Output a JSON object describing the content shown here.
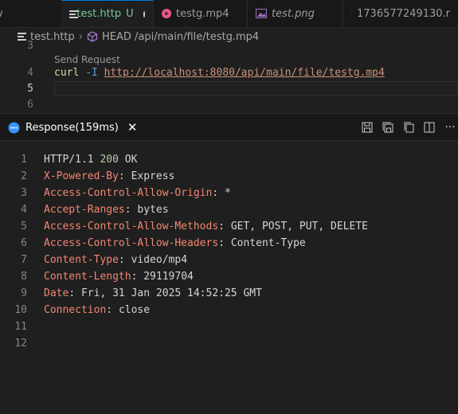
{
  "tabs": [
    {
      "label": "v"
    },
    {
      "label": "test.http",
      "status": "U"
    },
    {
      "label": "testg.mp4"
    },
    {
      "label": "test.png"
    },
    {
      "label": "1736577249130.r"
    }
  ],
  "breadcrumb": {
    "file": "test.http",
    "request": "HEAD /api/main/file/testg.mp4"
  },
  "editor": {
    "lines": [
      {
        "num": "3",
        "text": ""
      },
      {
        "num": "4",
        "cmd": "curl",
        "flag": "-I",
        "url": "http://localhost:8080/api/main/file/testg.mp4"
      },
      {
        "num": "5",
        "text": ""
      },
      {
        "num": "6",
        "text": ""
      }
    ],
    "codelens": "Send Request"
  },
  "response_panel": {
    "tab_label": "Response(159ms)"
  },
  "response": {
    "lines": [
      {
        "num": "1",
        "protocol": "HTTP/1.1 ",
        "code": "200",
        "reason": " OK"
      },
      {
        "num": "2",
        "name": "X-Powered-By",
        "value": "Express"
      },
      {
        "num": "3",
        "name": "Access-Control-Allow-Origin",
        "value": "*"
      },
      {
        "num": "4",
        "name": "Accept-Ranges",
        "value": "bytes"
      },
      {
        "num": "5",
        "name": "Access-Control-Allow-Methods",
        "value": "GET, POST, PUT, DELETE"
      },
      {
        "num": "6",
        "name": "Access-Control-Allow-Headers",
        "value": "Content-Type"
      },
      {
        "num": "7",
        "name": "Content-Type",
        "value": "video/mp4"
      },
      {
        "num": "8",
        "name": "Content-Length",
        "value": "29119704"
      },
      {
        "num": "9",
        "name": "Date",
        "value": "Fri, 31 Jan 2025 14:52:25 GMT"
      },
      {
        "num": "10",
        "name": "Connection",
        "value": "close"
      },
      {
        "num": "11"
      },
      {
        "num": "12"
      }
    ]
  },
  "colors": {
    "background": "#1f1f1f",
    "accent": "#0078d4",
    "untracked": "#73c991",
    "header_name": "#f48771",
    "url": "#ce9178"
  },
  "icons": [
    "file-lines-icon",
    "media-icon",
    "image-icon",
    "cube-icon",
    "loading-icon",
    "close-icon",
    "save-icon",
    "save-all-icon",
    "copy-icon",
    "split-icon",
    "more-icon"
  ]
}
